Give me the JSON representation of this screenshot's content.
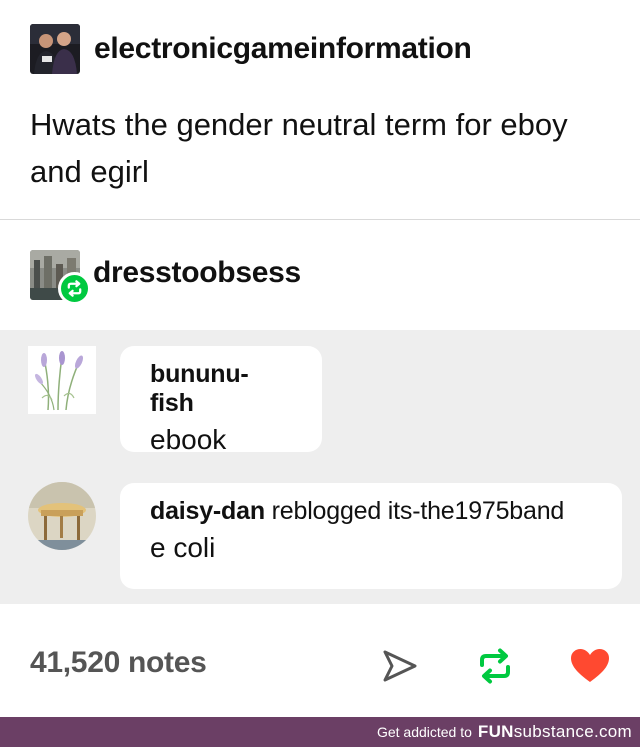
{
  "post": {
    "username": "electronicgameinformation",
    "text": "Hwats the gender neutral term for eboy and egirl"
  },
  "reblog": {
    "username": "dresstoobsess"
  },
  "comments": [
    {
      "user": "bununu-fish",
      "meta": "",
      "message": "ebook"
    },
    {
      "user": "daisy-dan",
      "meta": "reblogged its-the1975band",
      "message": "e coli"
    }
  ],
  "footer": {
    "notes": "41,520 notes",
    "icons": [
      "send-icon",
      "reblog-icon",
      "heart-icon"
    ]
  },
  "banner": {
    "tagline": "Get addicted to",
    "brand_bold": "FUN",
    "brand_rest": "substance.com"
  },
  "colors": {
    "reblog_green": "#00c940",
    "heart_red": "#ff4930",
    "banner_purple": "#6b3f65",
    "thread_bg": "#eeeeee"
  }
}
